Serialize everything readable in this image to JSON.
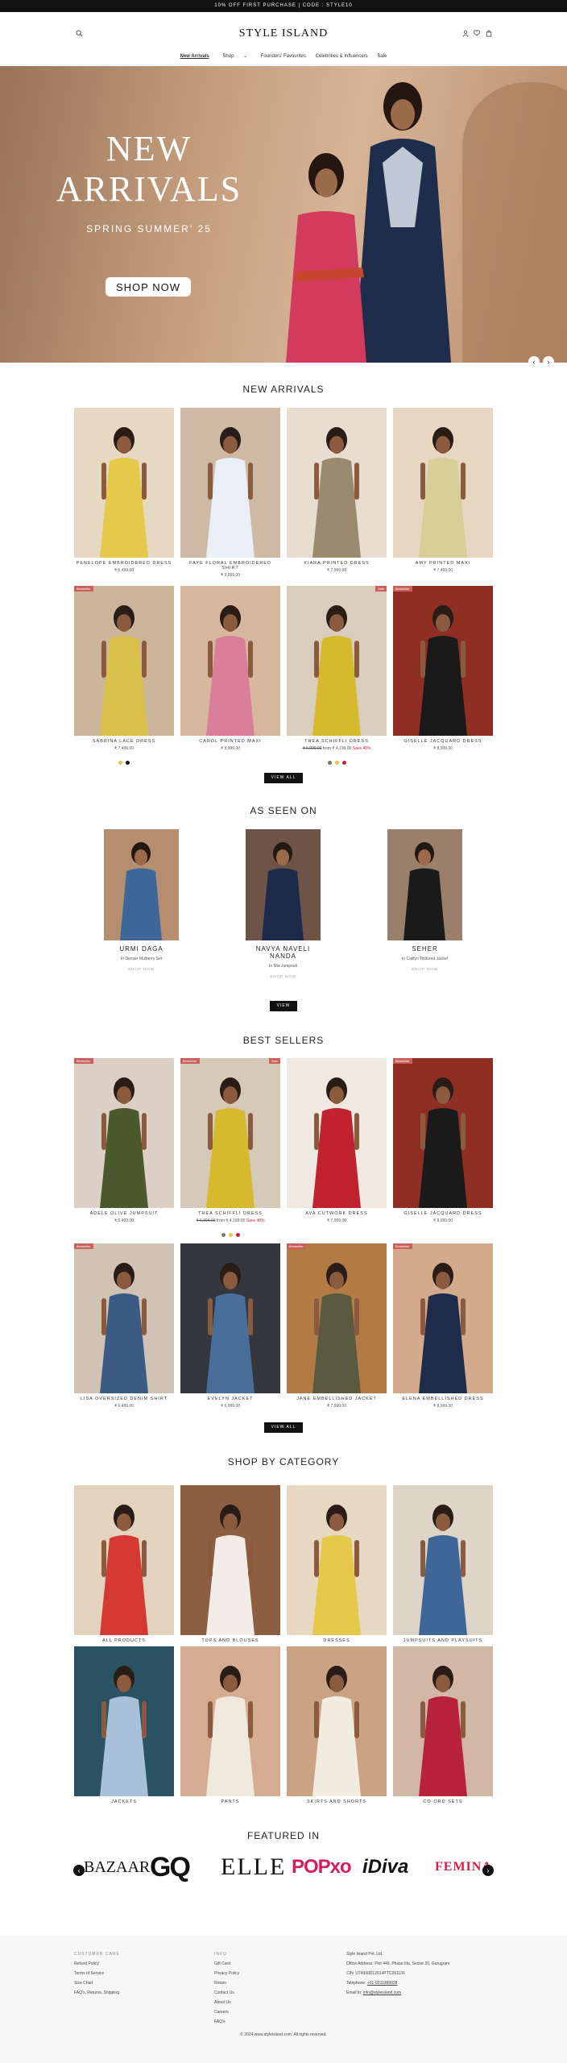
{
  "announcement": "10% OFF FIRST PURCHASE | CODE : STYLE10",
  "header": {
    "logo": "STYLE ISLAND",
    "nav": [
      "New Arrivals",
      "Shop",
      "Founders' Favourites",
      "Celebrities & Influencers",
      "Sale"
    ],
    "nav_chevron": "⌄",
    "icons": [
      "search-icon",
      "user-icon",
      "heart-icon",
      "bag-icon"
    ]
  },
  "hero": {
    "line1": "NEW",
    "line2": "ARRIVALS",
    "subtitle": "SPRING SUMMER' 25",
    "cta": "SHOP NOW",
    "prev": "‹",
    "next": "›"
  },
  "new_arrivals": {
    "title": "NEW ARRIVALS",
    "cta": "VIEW ALL",
    "products": [
      {
        "name": "PENELOPE EMBROIDERED DRESS",
        "price": "₹ 5,499.00",
        "bg": "#e7d8c4",
        "dress": "#e4c94a",
        "skin": "#8a5b3f"
      },
      {
        "name": "FAYE FLORAL EMBROIDERED SHIRT",
        "price": "₹ 3,999.00",
        "bg": "#cdb9a4",
        "dress": "#e9eef7",
        "skin": "#8a5b3f"
      },
      {
        "name": "KIARA PRINTED DRESS",
        "price": "₹ 7,999.00",
        "bg": "#e8ddd0",
        "dress": "#9b8a6f",
        "skin": "#8a5b3f"
      },
      {
        "name": "AMY PRINTED MAXI",
        "price": "₹ 7,499.00",
        "bg": "#e6d6c2",
        "dress": "#d7cf97",
        "skin": "#8a5b3f"
      },
      {
        "name": "SABRINA LACE DRESS",
        "price": "₹ 7,499.00",
        "bg": "#cdb59c",
        "dress": "#d9c04a",
        "skin": "#8a5b3f",
        "tag": "Bestseller",
        "swatches": [
          "#e0c53c",
          "#111111"
        ]
      },
      {
        "name": "CAROL PRINTED MAXI",
        "price": "₹ 5,999.00",
        "bg": "#d8b79f",
        "dress": "#d97f99",
        "skin": "#8a5b3f"
      },
      {
        "name": "THEA SCHIFFLI DRESS",
        "price_old": "₹ 6,999.00",
        "price_from": "from ₹ 4,199.00",
        "price_save": "Save 40%",
        "bg": "#d9cdbd",
        "dress": "#d7b92e",
        "skin": "#8a5b3f",
        "tag_right": "Sale",
        "swatches": [
          "#6e7d66",
          "#e4c94a",
          "#c0243a"
        ]
      },
      {
        "name": "GISELLE JACQUARD DRESS",
        "price": "₹ 8,999.00",
        "bg": "#8f2f23",
        "dress": "#1b1a1a",
        "skin": "#8a5b3f",
        "tag": "Bestseller"
      }
    ]
  },
  "as_seen_on": {
    "title": "AS SEEN ON",
    "cta": "VIEW",
    "link_label": "SHOP NOW",
    "celebs": [
      {
        "name": "URMI DAGA",
        "desc": "In Denver Mulberry Set",
        "bg": "#b58e6f",
        "dress": "#3f6698"
      },
      {
        "name": "NAVYA NAVELI NANDA",
        "desc": "In Mia Jumpsuit",
        "bg": "#6d5447",
        "dress": "#1d2a4a"
      },
      {
        "name": "SEHER",
        "desc": "In Caitlyn Textured Jacket",
        "bg": "#9a7f6a",
        "dress": "#1a1a1a"
      }
    ]
  },
  "best_sellers": {
    "title": "BEST SELLERS",
    "cta": "VIEW ALL",
    "products": [
      {
        "name": "ADELE OLIVE JUMPSUIT",
        "price": "₹ 5,499.00",
        "bg": "#dcd0c6",
        "dress": "#4b5a2d",
        "skin": "#8a5b3f",
        "tag": "Bestseller"
      },
      {
        "name": "THEA SCHIFFLI DRESS",
        "price_old": "₹ 6,999.00",
        "price_from": "from ₹ 4,199.00",
        "price_save": "Save 40%",
        "bg": "#d5c9b8",
        "dress": "#d7b92e",
        "skin": "#8a5b3f",
        "tag": "Bestseller",
        "tag_right": "Sale",
        "swatches": [
          "#6e7d66",
          "#e4c94a",
          "#c0243a"
        ]
      },
      {
        "name": "AVA CUTWORK DRESS",
        "price": "₹ 7,999.00",
        "bg": "#efe9e2",
        "dress": "#c0232e",
        "skin": "#8a5b3f"
      },
      {
        "name": "GISELLE JACQUARD DRESS",
        "price": "₹ 8,999.00",
        "bg": "#8f2f23",
        "dress": "#1b1a1a",
        "skin": "#8a5b3f",
        "tag": "Bestseller"
      },
      {
        "name": "LISA OVERSIZED DENIM SHIRT",
        "price": "₹ 5,499.00",
        "bg": "#d1c3b4",
        "dress": "#3c5b84",
        "skin": "#8a5b3f",
        "tag": "Bestseller"
      },
      {
        "name": "EVELYN JACKET",
        "price": "₹ 6,999.00",
        "bg": "#34383e",
        "dress": "#4a6e9a",
        "skin": "#8a5b3f"
      },
      {
        "name": "JANE EMBELLISHED JACKET",
        "price": "₹ 7,999.00",
        "bg": "#b27b45",
        "dress": "#5a5a40",
        "skin": "#8a5b3f",
        "tag": "Bestseller"
      },
      {
        "name": "ELENA EMBELLISHED DRESS",
        "price": "₹ 8,999.00",
        "bg": "#d3ab8c",
        "dress": "#1f2b4b",
        "skin": "#8a5b3f",
        "tag": "Bestseller"
      }
    ]
  },
  "shop_by_category": {
    "title": "SHOP BY CATEGORY",
    "categories": [
      {
        "name": "ALL PRODUCTS",
        "bg": "#e3d3bf",
        "dress": "#d43a33",
        "skin": "#8a5b3f"
      },
      {
        "name": "TOPS AND BLOUSES",
        "bg": "#8e5e43",
        "dress": "#f1ede6",
        "skin": "#8a5b3f"
      },
      {
        "name": "DRESSES",
        "bg": "#e7d8c4",
        "dress": "#e4c94a",
        "skin": "#8a5b3f"
      },
      {
        "name": "JUMPSUITS AND PLAYSUITS",
        "bg": "#dfd4c8",
        "dress": "#3f6698",
        "skin": "#8a5b3f"
      },
      {
        "name": "JACKETS",
        "bg": "#2b5263",
        "dress": "#a9c0da",
        "skin": "#8a5b3f"
      },
      {
        "name": "PANTS",
        "bg": "#d5ac91",
        "dress": "#efe8dc",
        "skin": "#8a5b3f"
      },
      {
        "name": "SKIRTS AND SHORTS",
        "bg": "#caa284",
        "dress": "#f2ece0",
        "skin": "#8a5b3f"
      },
      {
        "name": "CO-ORD SETS",
        "bg": "#d2b6a6",
        "dress": "#b8213a",
        "skin": "#8a5b3f"
      }
    ]
  },
  "featured_in": {
    "title": "FEATURED IN",
    "logos": [
      "BAZAAR",
      "GQ",
      "ELLE",
      "POPxo",
      "iDiva",
      "FEMINA"
    ],
    "prev": "‹",
    "next": "›"
  },
  "footer": {
    "customer_care": {
      "heading": "CUSTOMER CARE",
      "links": [
        "Refund Policy",
        "Terms of Service",
        "Size Chart",
        "FAQ's, Returns, Shipping"
      ]
    },
    "info": {
      "heading": "INFO",
      "links": [
        "Gift Card",
        "Privacy Policy",
        "Return",
        "Contact Us",
        "About Us",
        "Careers",
        "FAQ's"
      ]
    },
    "company": {
      "name": "Style Island Pvt. Ltd.",
      "address": "Office Address: Plot 449, Phase IIIa, Sector 20, Gurugram",
      "cin": "CIN: U74900DL2014PTC261136",
      "phone_label": "Telephone:",
      "phone": "+91-9311988938",
      "email_label": "Email to:",
      "email": "info@styleisland.com"
    },
    "copyright": "© 2024 www.styleisland.com. All rights reserved."
  }
}
